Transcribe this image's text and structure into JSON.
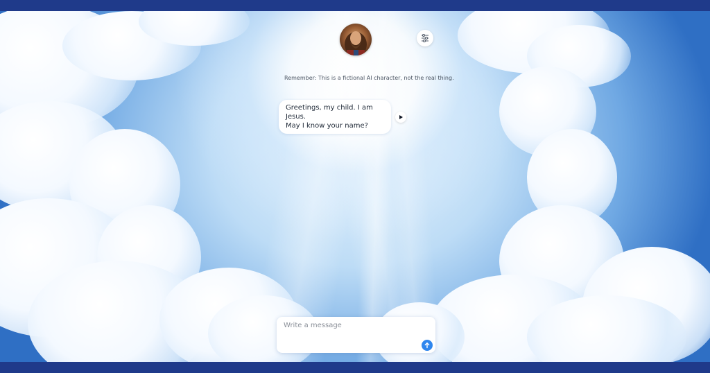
{
  "character": {
    "avatar_icon": "jesus-portrait-avatar",
    "settings_icon": "sliders-icon"
  },
  "disclaimer": "Remember: This is a fictional AI character, not the real thing.",
  "messages": [
    {
      "role": "character",
      "line1": "Greetings, my child. I am Jesus.",
      "line2": "May I know your name?",
      "action_icon": "play-icon"
    }
  ],
  "composer": {
    "placeholder": "Write a message",
    "value": "",
    "send_icon": "arrow-up-icon"
  },
  "colors": {
    "frame": "#1f3a8a",
    "send_button": "#2f86ee",
    "bubble": "#ffffff"
  }
}
